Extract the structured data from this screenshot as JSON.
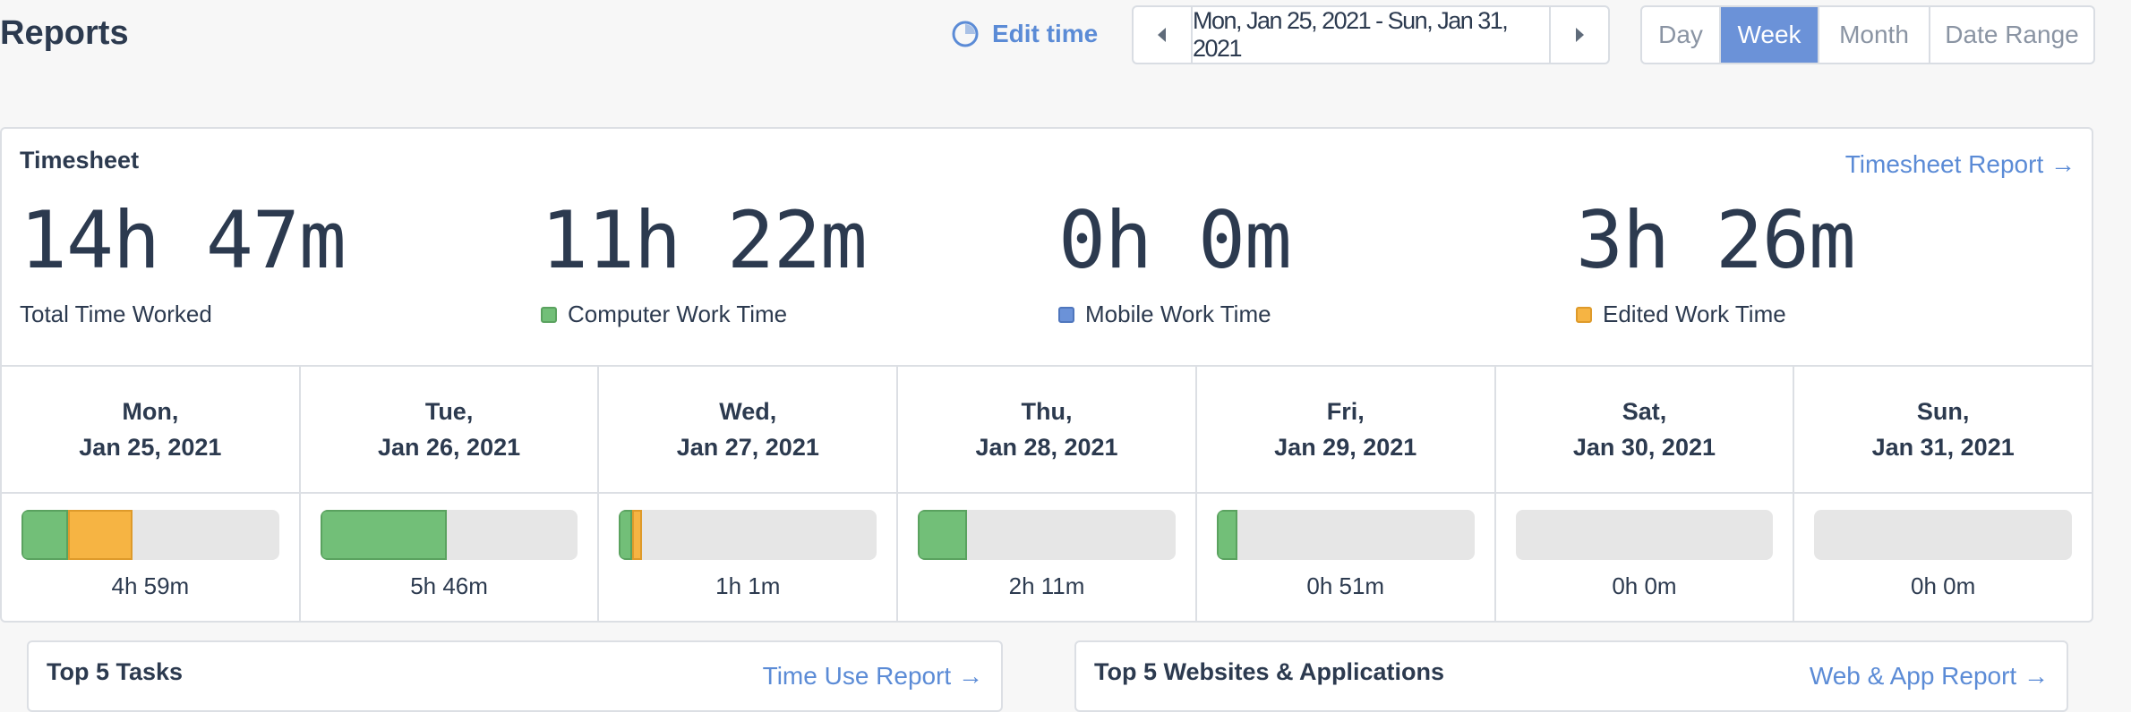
{
  "header": {
    "title": "Reports",
    "edit_time_label": "Edit time",
    "date_range": "Mon, Jan 25, 2021 - Sun, Jan 31, 2021",
    "periods": [
      "Day",
      "Week",
      "Month",
      "Date Range"
    ],
    "active_period": "Week"
  },
  "timesheet": {
    "title": "Timesheet",
    "report_link": "Timesheet Report →",
    "stats": [
      {
        "value": "14h 47m",
        "label": "Total Time Worked"
      },
      {
        "value": "11h 22m",
        "label": "Computer Work Time",
        "color": "#72bf78"
      },
      {
        "value": "0h 0m",
        "label": "Mobile Work Time",
        "color": "#6b92d8"
      },
      {
        "value": "3h 26m",
        "label": "Edited Work Time",
        "color": "#f6b443"
      }
    ],
    "days": [
      {
        "weekday": "Mon,",
        "date": "Jan 25, 2021",
        "total": "4h 59m",
        "computer_fraction": 0.18,
        "edited_fraction": 0.25
      },
      {
        "weekday": "Tue,",
        "date": "Jan 26, 2021",
        "total": "5h 46m",
        "computer_fraction": 0.49,
        "edited_fraction": 0
      },
      {
        "weekday": "Wed,",
        "date": "Jan 27, 2021",
        "total": "1h 1m",
        "computer_fraction": 0.05,
        "edited_fraction": 0.04
      },
      {
        "weekday": "Thu,",
        "date": "Jan 28, 2021",
        "total": "2h 11m",
        "computer_fraction": 0.19,
        "edited_fraction": 0
      },
      {
        "weekday": "Fri,",
        "date": "Jan 29, 2021",
        "total": "0h 51m",
        "computer_fraction": 0.08,
        "edited_fraction": 0
      },
      {
        "weekday": "Sat,",
        "date": "Jan 30, 2021",
        "total": "0h 0m",
        "computer_fraction": 0,
        "edited_fraction": 0
      },
      {
        "weekday": "Sun,",
        "date": "Jan 31, 2021",
        "total": "0h 0m",
        "computer_fraction": 0,
        "edited_fraction": 0
      }
    ]
  },
  "tasks_card": {
    "title": "Top 5 Tasks",
    "link": "Time Use Report →"
  },
  "websites_card": {
    "title": "Top 5 Websites & Applications",
    "link": "Web & App Report →"
  }
}
